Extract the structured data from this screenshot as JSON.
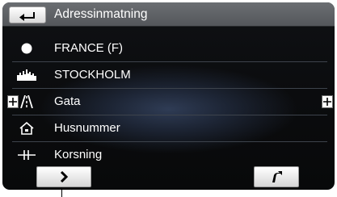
{
  "header": {
    "title": "Adressinmatning",
    "back_icon": "back-arrow-icon"
  },
  "rows": [
    {
      "label": "FRANCE (F)",
      "icon": "country-dot-icon"
    },
    {
      "label": "STOCKHOLM",
      "icon": "city-skyline-icon"
    },
    {
      "label": "Gata",
      "icon": "road-icon"
    },
    {
      "label": "Husnummer",
      "icon": "house-icon"
    },
    {
      "label": "Korsning",
      "icon": "intersection-icon"
    }
  ],
  "footer": {
    "next_icon": "chevron-right-icon",
    "navigate_icon": "route-arrow-icon"
  },
  "side_controls": {
    "left_icon": "plus-icon",
    "right_icon": "plus-icon"
  },
  "colors": {
    "header_bg": "#5f6266",
    "screen_bg": "#0b0c0e",
    "glow": "#2f3c55",
    "text": "#ffffff",
    "button_face": "#ffffff"
  }
}
